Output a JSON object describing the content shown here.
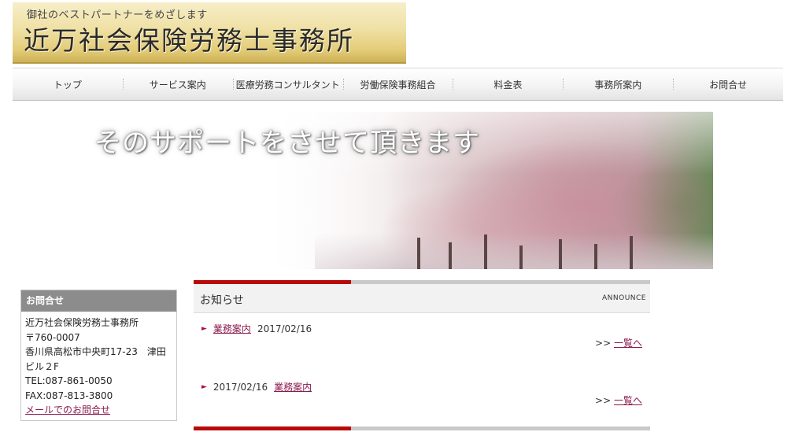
{
  "header": {
    "tagline": "御社のベストパートナーをめざします",
    "office_name": "近万社会保険労務士事務所"
  },
  "nav": {
    "items": [
      {
        "label": "トップ"
      },
      {
        "label": "サービス案内"
      },
      {
        "label": "医療労務コンサルタント"
      },
      {
        "label": "労働保険事務組合"
      },
      {
        "label": "料金表"
      },
      {
        "label": "事務所案内"
      },
      {
        "label": "お問合せ"
      }
    ]
  },
  "hero": {
    "message": "そのサポートをさせて頂きます"
  },
  "contact": {
    "heading": "お問合せ",
    "name": "近万社会保険労務士事務所",
    "postal": "〒760-0007",
    "address": "香川県高松市中央町17-23　津田ビル２F",
    "tel": "TEL:087-861-0050",
    "fax": "FAX:087-813-3800",
    "mail_link": "メールでのお問合せ"
  },
  "announce": {
    "title": "お知らせ",
    "subtitle": "ANNOUNCE",
    "more_prefix": ">>",
    "more_link": "一覧へ",
    "entries": [
      {
        "link": "業務案内",
        "date": "2017/02/16"
      },
      {
        "date": "2017/02/16",
        "link": "業務案内"
      }
    ]
  },
  "colors": {
    "accent_red": "#b90a0a",
    "link": "#8b1a4d",
    "sidebar_head": "#8c8c8c"
  }
}
